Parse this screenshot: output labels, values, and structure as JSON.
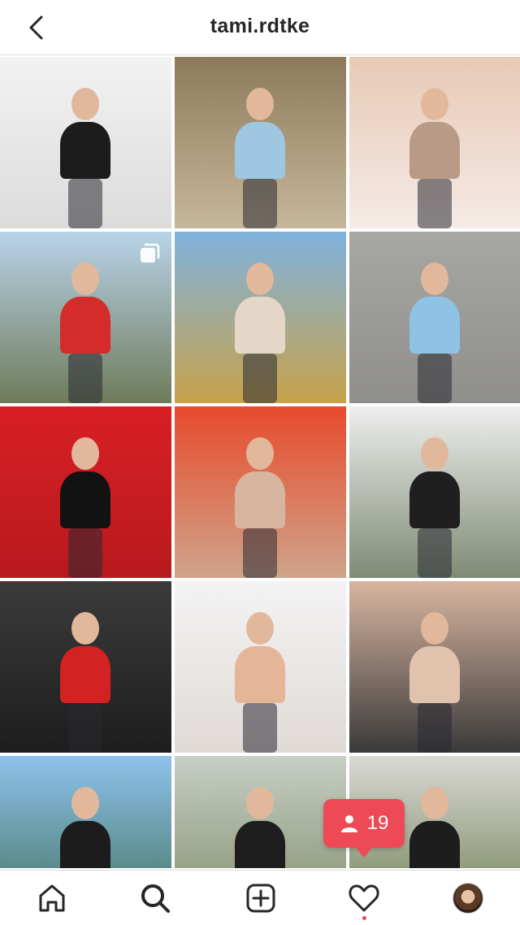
{
  "header": {
    "title": "tami.rdtke",
    "back_icon": "chevron-left-icon"
  },
  "grid": {
    "tiles": [
      {
        "name": "post-black-dress",
        "multi": false,
        "bg": [
          "#f2f2f2",
          "#dcdcdc"
        ],
        "accent": "#1c1c1c"
      },
      {
        "name": "post-path-jeans",
        "multi": false,
        "bg": [
          "#8d7a5c",
          "#c7b79a"
        ],
        "accent": "#9fc7e2"
      },
      {
        "name": "post-selfie-lace",
        "multi": false,
        "bg": [
          "#e8c9b5",
          "#f5ebe6"
        ],
        "accent": "#b99a86"
      },
      {
        "name": "post-red-jacket-trail",
        "multi": true,
        "bg": [
          "#b9d3ea",
          "#6e7b5a"
        ],
        "accent": "#d52b2b"
      },
      {
        "name": "post-field-sunset",
        "multi": false,
        "bg": [
          "#7fb2df",
          "#c7a24a"
        ],
        "accent": "#e5d7c7"
      },
      {
        "name": "post-bench-overalls",
        "multi": false,
        "bg": [
          "#a7a7a3",
          "#8f8e8a"
        ],
        "accent": "#8ec3e6"
      },
      {
        "name": "post-locker-mirror",
        "multi": false,
        "bg": [
          "#d81f24",
          "#b81a1e"
        ],
        "accent": "#121212"
      },
      {
        "name": "post-car-selfie",
        "multi": false,
        "bg": [
          "#e84a2c",
          "#cfa48a"
        ],
        "accent": "#d7b59f"
      },
      {
        "name": "post-bunny-ears",
        "multi": false,
        "bg": [
          "#eeeeee",
          "#7e8b74"
        ],
        "accent": "#1f1f1f"
      },
      {
        "name": "post-mma-gym",
        "multi": false,
        "bg": [
          "#3b3b3b",
          "#1d1d1d"
        ],
        "accent": "#d32222"
      },
      {
        "name": "post-transformation",
        "multi": false,
        "bg": [
          "#f3f3f3",
          "#e0dad6"
        ],
        "accent": "#e5b598"
      },
      {
        "name": "post-car-selfie-2",
        "multi": false,
        "bg": [
          "#d8b5a0",
          "#3a3a3a"
        ],
        "accent": "#e1c2ad"
      },
      {
        "name": "post-mountain-lake",
        "multi": false,
        "bg": [
          "#8ec2ec",
          "#3f6e58"
        ],
        "accent": "#1c1c1c"
      },
      {
        "name": "post-street-jeans",
        "multi": false,
        "bg": [
          "#c8cfc6",
          "#7c8a66"
        ],
        "accent": "#1e1e1e"
      },
      {
        "name": "post-park-pose",
        "multi": false,
        "bg": [
          "#d9d9d4",
          "#6b7b4f"
        ],
        "accent": "#1d1d1d"
      }
    ]
  },
  "notification": {
    "count": "19",
    "icon": "person-icon"
  },
  "tabbar": {
    "items": [
      {
        "name": "tab-home",
        "icon": "home-icon"
      },
      {
        "name": "tab-search",
        "icon": "search-icon"
      },
      {
        "name": "tab-new-post",
        "icon": "plus-square-icon"
      },
      {
        "name": "tab-activity",
        "icon": "heart-icon"
      },
      {
        "name": "tab-profile",
        "icon": "avatar-icon"
      }
    ]
  }
}
